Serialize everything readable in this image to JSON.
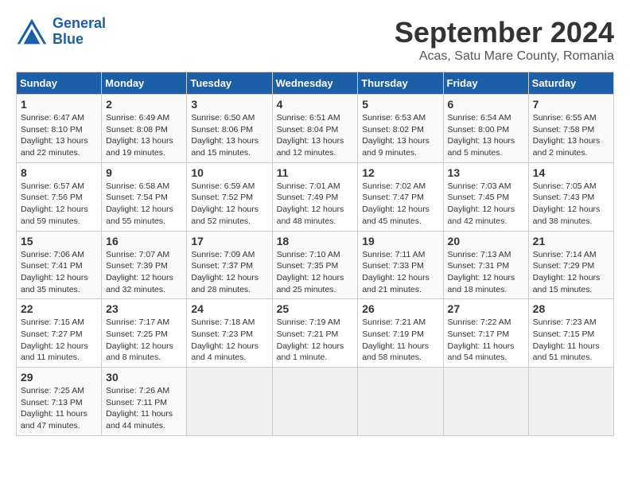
{
  "header": {
    "logo_line1": "General",
    "logo_line2": "Blue",
    "month_title": "September 2024",
    "subtitle": "Acas, Satu Mare County, Romania"
  },
  "days_of_week": [
    "Sunday",
    "Monday",
    "Tuesday",
    "Wednesday",
    "Thursday",
    "Friday",
    "Saturday"
  ],
  "weeks": [
    [
      {
        "day": "1",
        "sunrise": "6:47 AM",
        "sunset": "8:10 PM",
        "daylight": "13 hours and 22 minutes."
      },
      {
        "day": "2",
        "sunrise": "6:49 AM",
        "sunset": "8:08 PM",
        "daylight": "13 hours and 19 minutes."
      },
      {
        "day": "3",
        "sunrise": "6:50 AM",
        "sunset": "8:06 PM",
        "daylight": "13 hours and 15 minutes."
      },
      {
        "day": "4",
        "sunrise": "6:51 AM",
        "sunset": "8:04 PM",
        "daylight": "13 hours and 12 minutes."
      },
      {
        "day": "5",
        "sunrise": "6:53 AM",
        "sunset": "8:02 PM",
        "daylight": "13 hours and 9 minutes."
      },
      {
        "day": "6",
        "sunrise": "6:54 AM",
        "sunset": "8:00 PM",
        "daylight": "13 hours and 5 minutes."
      },
      {
        "day": "7",
        "sunrise": "6:55 AM",
        "sunset": "7:58 PM",
        "daylight": "13 hours and 2 minutes."
      }
    ],
    [
      {
        "day": "8",
        "sunrise": "6:57 AM",
        "sunset": "7:56 PM",
        "daylight": "12 hours and 59 minutes."
      },
      {
        "day": "9",
        "sunrise": "6:58 AM",
        "sunset": "7:54 PM",
        "daylight": "12 hours and 55 minutes."
      },
      {
        "day": "10",
        "sunrise": "6:59 AM",
        "sunset": "7:52 PM",
        "daylight": "12 hours and 52 minutes."
      },
      {
        "day": "11",
        "sunrise": "7:01 AM",
        "sunset": "7:49 PM",
        "daylight": "12 hours and 48 minutes."
      },
      {
        "day": "12",
        "sunrise": "7:02 AM",
        "sunset": "7:47 PM",
        "daylight": "12 hours and 45 minutes."
      },
      {
        "day": "13",
        "sunrise": "7:03 AM",
        "sunset": "7:45 PM",
        "daylight": "12 hours and 42 minutes."
      },
      {
        "day": "14",
        "sunrise": "7:05 AM",
        "sunset": "7:43 PM",
        "daylight": "12 hours and 38 minutes."
      }
    ],
    [
      {
        "day": "15",
        "sunrise": "7:06 AM",
        "sunset": "7:41 PM",
        "daylight": "12 hours and 35 minutes."
      },
      {
        "day": "16",
        "sunrise": "7:07 AM",
        "sunset": "7:39 PM",
        "daylight": "12 hours and 32 minutes."
      },
      {
        "day": "17",
        "sunrise": "7:09 AM",
        "sunset": "7:37 PM",
        "daylight": "12 hours and 28 minutes."
      },
      {
        "day": "18",
        "sunrise": "7:10 AM",
        "sunset": "7:35 PM",
        "daylight": "12 hours and 25 minutes."
      },
      {
        "day": "19",
        "sunrise": "7:11 AM",
        "sunset": "7:33 PM",
        "daylight": "12 hours and 21 minutes."
      },
      {
        "day": "20",
        "sunrise": "7:13 AM",
        "sunset": "7:31 PM",
        "daylight": "12 hours and 18 minutes."
      },
      {
        "day": "21",
        "sunrise": "7:14 AM",
        "sunset": "7:29 PM",
        "daylight": "12 hours and 15 minutes."
      }
    ],
    [
      {
        "day": "22",
        "sunrise": "7:15 AM",
        "sunset": "7:27 PM",
        "daylight": "12 hours and 11 minutes."
      },
      {
        "day": "23",
        "sunrise": "7:17 AM",
        "sunset": "7:25 PM",
        "daylight": "12 hours and 8 minutes."
      },
      {
        "day": "24",
        "sunrise": "7:18 AM",
        "sunset": "7:23 PM",
        "daylight": "12 hours and 4 minutes."
      },
      {
        "day": "25",
        "sunrise": "7:19 AM",
        "sunset": "7:21 PM",
        "daylight": "12 hours and 1 minute."
      },
      {
        "day": "26",
        "sunrise": "7:21 AM",
        "sunset": "7:19 PM",
        "daylight": "11 hours and 58 minutes."
      },
      {
        "day": "27",
        "sunrise": "7:22 AM",
        "sunset": "7:17 PM",
        "daylight": "11 hours and 54 minutes."
      },
      {
        "day": "28",
        "sunrise": "7:23 AM",
        "sunset": "7:15 PM",
        "daylight": "11 hours and 51 minutes."
      }
    ],
    [
      {
        "day": "29",
        "sunrise": "7:25 AM",
        "sunset": "7:13 PM",
        "daylight": "11 hours and 47 minutes."
      },
      {
        "day": "30",
        "sunrise": "7:26 AM",
        "sunset": "7:11 PM",
        "daylight": "11 hours and 44 minutes."
      },
      null,
      null,
      null,
      null,
      null
    ]
  ]
}
